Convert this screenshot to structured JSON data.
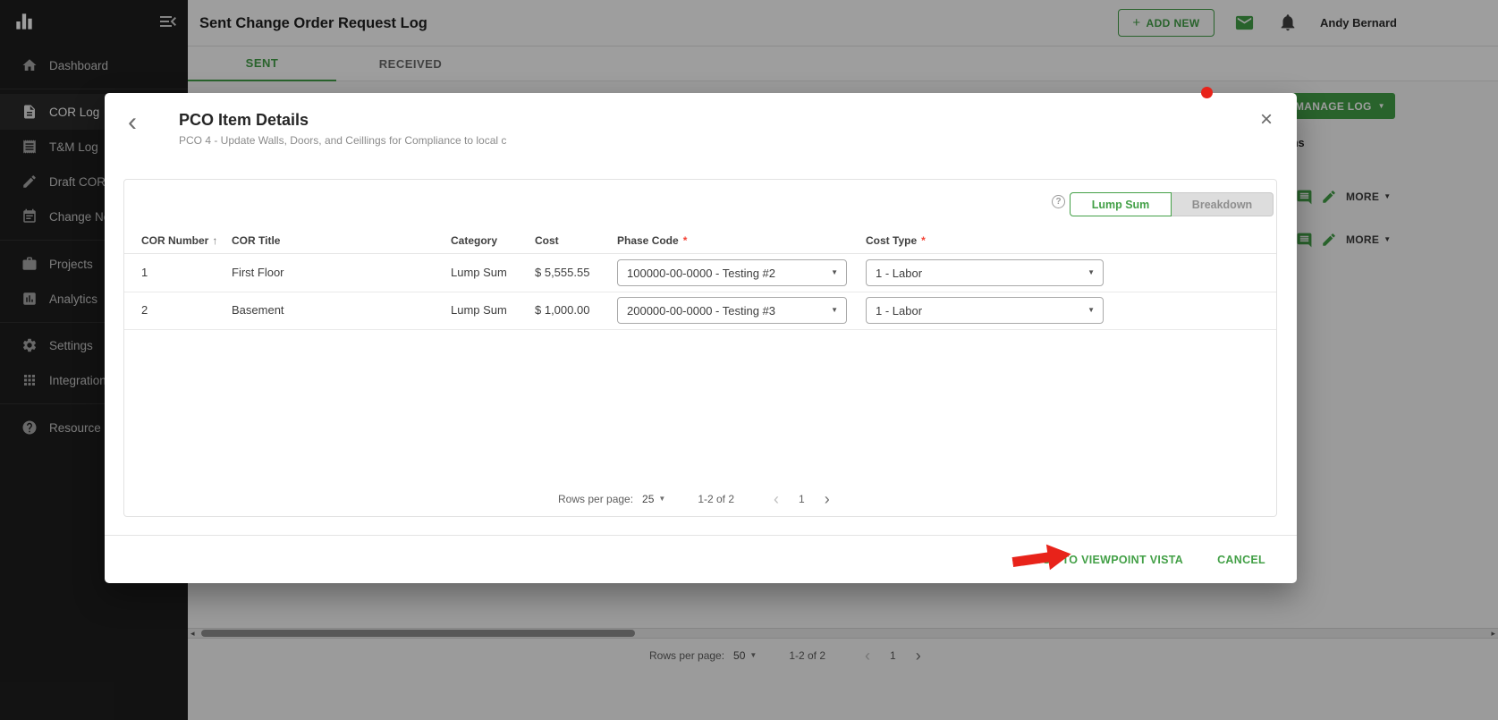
{
  "colors": {
    "accent": "#43A047",
    "danger": "#F44336",
    "arrow": "#E8231A",
    "sidebar_bg": "#1E1E1E"
  },
  "icons": {
    "plus": "+",
    "caret_down": "▼",
    "chevron_left": "‹",
    "chevron_right": "›",
    "close": "×",
    "back": "‹",
    "sort_asc": "↑",
    "help": "?",
    "scroll_left": "◂",
    "scroll_right": "▸",
    "required": "*"
  },
  "sidebar": {
    "items": [
      {
        "label": "Dashboard"
      },
      {
        "label": "COR Log"
      },
      {
        "label": "T&M Log"
      },
      {
        "label": "Draft COR L"
      },
      {
        "label": "Change No"
      },
      {
        "label": "Projects"
      },
      {
        "label": "Analytics"
      },
      {
        "label": "Settings"
      },
      {
        "label": "Integrations"
      },
      {
        "label": "Resource C"
      }
    ]
  },
  "header": {
    "title": "Sent Change Order Request Log",
    "add_new": "ADD NEW",
    "user": "Andy Bernard"
  },
  "tabs": {
    "sent": "SENT",
    "received": "RECEIVED"
  },
  "background": {
    "manage_log": "MANAGE LOG",
    "actions_header": "ns",
    "more": "MORE",
    "pagination": {
      "rows_per_page_label": "Rows per page:",
      "rows_per_page": "50",
      "range": "1-2 of 2",
      "page": "1"
    }
  },
  "modal": {
    "title": "PCO Item Details",
    "subtitle": "PCO 4 - Update Walls, Doors, and Ceillings for Compliance to local c",
    "toggle": {
      "lump_sum": "Lump Sum",
      "breakdown": "Breakdown"
    },
    "table": {
      "columns": {
        "cor_number": "COR Number",
        "cor_title": "COR Title",
        "category": "Category",
        "cost": "Cost",
        "phase_code": "Phase Code",
        "cost_type": "Cost Type"
      },
      "rows": [
        {
          "cor_number": "1",
          "cor_title": "First Floor",
          "category": "Lump Sum",
          "cost": "$ 5,555.55",
          "phase_code": "100000-00-0000 - Testing #2",
          "cost_type": "1 - Labor"
        },
        {
          "cor_number": "2",
          "cor_title": "Basement",
          "category": "Lump Sum",
          "cost": "$ 1,000.00",
          "phase_code": "200000-00-0000 - Testing #3",
          "cost_type": "1 - Labor"
        }
      ]
    },
    "pagination": {
      "rows_per_page_label": "Rows per page:",
      "rows_per_page": "25",
      "range": "1-2 of 2",
      "page": "1"
    },
    "footer": {
      "push": "PUSH TO VIEWPOINT VISTA",
      "cancel": "CANCEL"
    }
  }
}
